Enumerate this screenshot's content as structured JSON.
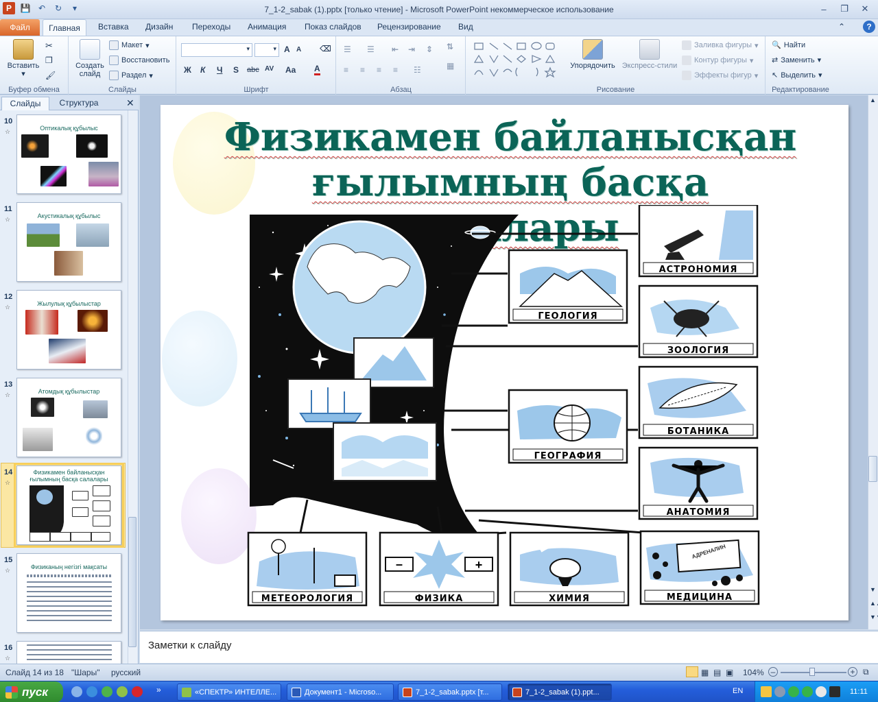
{
  "window": {
    "title": "7_1-2_sabak (1).pptx [только чтение]  -  Microsoft PowerPoint некоммерческое использование"
  },
  "tabs": {
    "file": "Файл",
    "items": [
      "Главная",
      "Вставка",
      "Дизайн",
      "Переходы",
      "Анимация",
      "Показ слайдов",
      "Рецензирование",
      "Вид"
    ]
  },
  "ribbon": {
    "clipboard": {
      "paste": "Вставить",
      "label": "Буфер обмена"
    },
    "slides": {
      "new_slide": "Создать слайд",
      "layout": "Макет",
      "reset": "Восстановить",
      "section": "Раздел",
      "label": "Слайды"
    },
    "font": {
      "label": "Шрифт",
      "bold": "Ж",
      "italic": "К",
      "underline": "Ч",
      "shadow": "S",
      "strike": "abc",
      "size_up": "A",
      "size_down": "A",
      "spacing": "AV",
      "case": "Aa",
      "color": "A"
    },
    "paragraph": {
      "label": "Абзац"
    },
    "drawing": {
      "arrange": "Упорядочить",
      "quick_styles": "Экспресс-стили",
      "fill": "Заливка фигуры",
      "outline": "Контур фигуры",
      "effects": "Эффекты фигур",
      "label": "Рисование"
    },
    "editing": {
      "find": "Найти",
      "replace": "Заменить",
      "select": "Выделить",
      "label": "Редактирование"
    }
  },
  "panel": {
    "tab_slides": "Слайды",
    "tab_outline": "Структура",
    "thumbnails": [
      {
        "num": "10",
        "title": "Оптикалық құбылыс"
      },
      {
        "num": "11",
        "title": "Акустикалық құбылыс"
      },
      {
        "num": "12",
        "title": "Жылулық құбылыстар"
      },
      {
        "num": "13",
        "title": "Атомдық құбылыстар"
      },
      {
        "num": "14",
        "title": "Физикамен байланысқан ғылымның басқа салалары"
      },
      {
        "num": "15",
        "title": "Физиканың негізгі мақсаты"
      },
      {
        "num": "16",
        "title": ""
      }
    ]
  },
  "slide": {
    "title_line1": "Физикамен байланысқан",
    "title_line2": "ғылымның басқа салалары",
    "boxes": {
      "astronomy": "АСТРОНОМИЯ",
      "geology": "ГЕОЛОГИЯ",
      "zoology": "ЗООЛОГИЯ",
      "botany": "БОТАНИКА",
      "geography": "ГЕОГРАФИЯ",
      "anatomy": "АНАТОМИЯ",
      "meteorology": "МЕТЕОРОЛОГИЯ",
      "physics": "ФИЗИКА",
      "chemistry": "ХИМИЯ",
      "medicine": "МЕДИЦИНА",
      "adrenaline": "АДРЕНАЛИН"
    }
  },
  "notes": {
    "placeholder": "Заметки к слайду"
  },
  "status": {
    "slide_counter": "Слайд 14 из 18",
    "theme": "\"Шары\"",
    "language": "русский",
    "zoom": "104%"
  },
  "taskbar": {
    "start": "пуск",
    "buttons": [
      "«СПЕКТР» ИНТЕЛЛЕ...",
      "Документ1 - Microso...",
      "7_1-2_sabak.pptx [т...",
      "7_1-2_sabak (1).ppt..."
    ],
    "lang": "EN",
    "clock": "11:11"
  },
  "colors": {
    "accent": "#d9662a",
    "title": "#0b6457",
    "ribbon": "#dfe9f5"
  }
}
